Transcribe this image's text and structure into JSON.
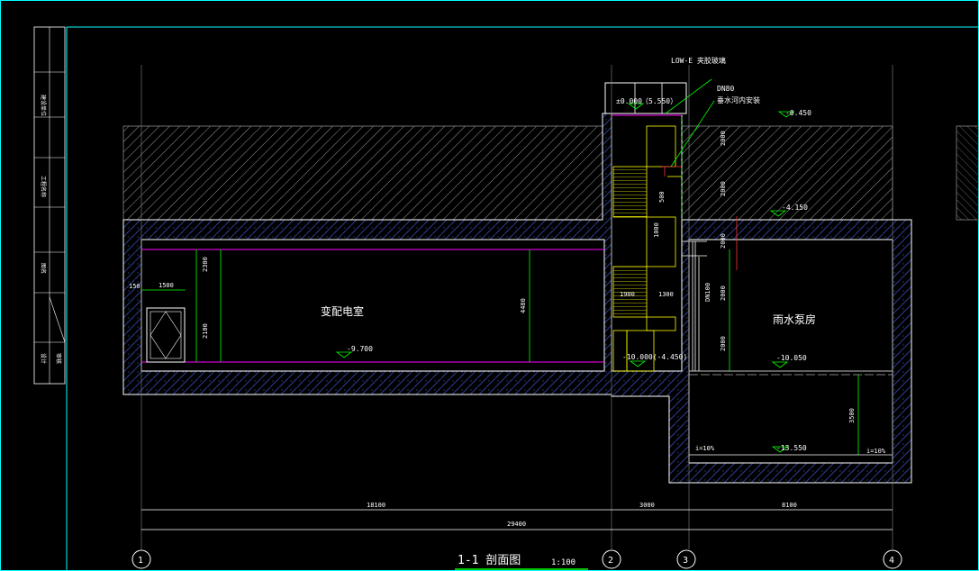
{
  "drawing": {
    "title": "1-1  剖面图",
    "scale": "1:100"
  },
  "rooms": {
    "left_room": "变配电室",
    "right_room": "雨水泵房"
  },
  "elevations": {
    "ground_left": "±0.000",
    "ground_paren": "（5.550）",
    "top_right": "-0.450",
    "mid_right": "-4.150",
    "left_floor": "-9.700",
    "stair_bottom": "-10.000(-4.450)",
    "pump_floor": "-10.050",
    "pit_bottom": "-13.550"
  },
  "annotations": {
    "glass_label": "LOW-E  夹胶玻璃",
    "pipe_label": "DN80",
    "pipe_note": "垂水河内安装",
    "slope_left": "i=10%",
    "slope_right": "i=10%"
  },
  "dimensions": {
    "d1500": "1500",
    "d150": "150",
    "d2300": "2300",
    "d2100": "2100",
    "d4480": "4480",
    "d1900": "1900",
    "d1300": "1300",
    "d1000": "1000",
    "d500": "500",
    "d2000a": "2000",
    "d2000b": "2000",
    "d2000c": "2000",
    "d2000d": "2000",
    "d2000e": "2000",
    "d3500": "3500",
    "dn100": "DN100",
    "span1": "18100",
    "span2": "3000",
    "span3": "8100",
    "total": "29400"
  },
  "axes": [
    "1",
    "2",
    "3",
    "4"
  ],
  "title_block": {
    "r1": "建设单位",
    "r2": "工程名称",
    "r3": "图名",
    "r4": "设计",
    "r5": "审核"
  }
}
